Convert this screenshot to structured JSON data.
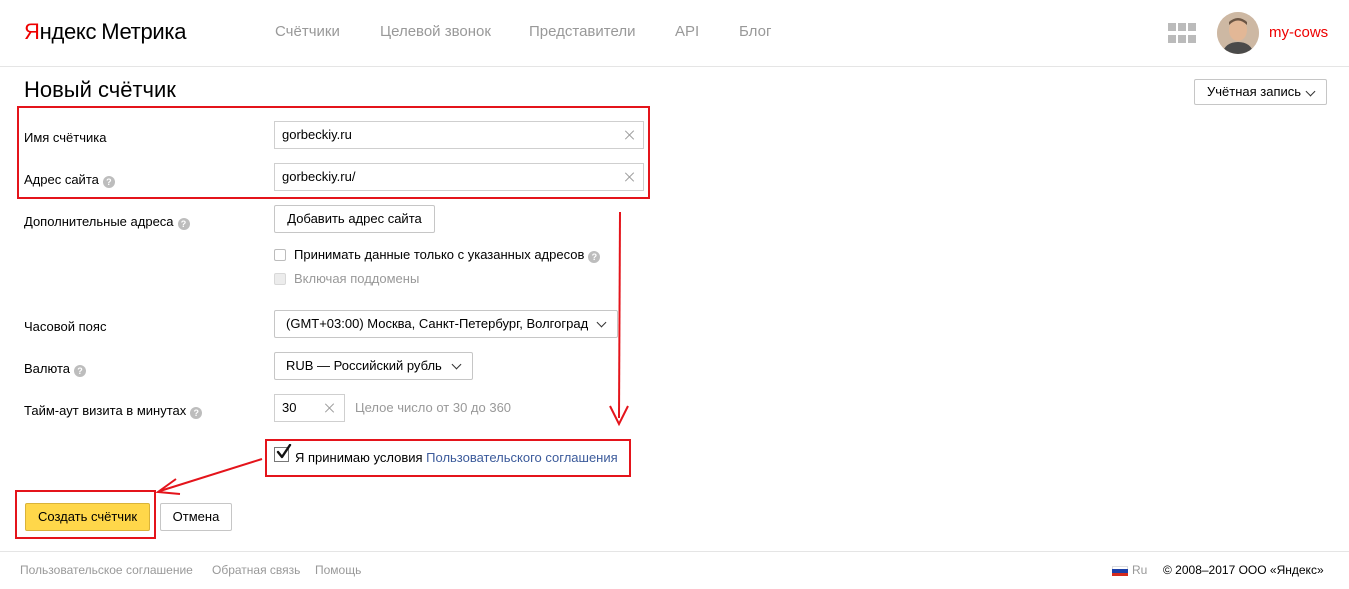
{
  "header": {
    "logo_yandex_first": "Я",
    "logo_yandex_rest": "ндекс",
    "logo_product": "Метрика",
    "nav": [
      "Счётчики",
      "Целевой звонок",
      "Представители",
      "API",
      "Блог"
    ],
    "user_name": "my-cows",
    "icons": {
      "apps": "grid-icon",
      "avatar": "user-avatar"
    }
  },
  "page": {
    "title": "Новый счётчик",
    "account_button": "Учётная запись"
  },
  "form": {
    "counter_name_label": "Имя счётчика",
    "counter_name_value": "gorbeckiy.ru",
    "site_address_label": "Адрес сайта",
    "site_address_value": "gorbeckiy.ru/",
    "extra_addresses_label": "Дополнительные адреса",
    "add_address_button": "Добавить адрес сайта",
    "only_listed_checkbox": "Принимать данные только с указанных адресов",
    "subdomains_checkbox": "Включая поддомены",
    "timezone_label": "Часовой пояс",
    "timezone_value": "(GMT+03:00) Москва, Санкт-Петербург, Волгоград",
    "currency_label": "Валюта",
    "currency_value": "RUB — Российский рубль",
    "timeout_label": "Тайм-аут визита в минутах",
    "timeout_value": "30",
    "timeout_hint": "Целое число от 30 до 360",
    "agree_text": "Я принимаю условия",
    "agree_link": "Пользовательского соглашения",
    "agree_checked": true,
    "create_button": "Создать счётчик",
    "cancel_button": "Отмена",
    "help_glyph": "?"
  },
  "footer": {
    "links": [
      "Пользовательское соглашение",
      "Обратная связь",
      "Помощь"
    ],
    "lang": "Ru",
    "copyright": "© 2008–2017 ООО «Яндекс»"
  },
  "colors": {
    "brand_red": "#ee0000",
    "annotation_red": "#e4141b",
    "primary_button": "#ffd74a",
    "link": "#3c5b9b"
  }
}
